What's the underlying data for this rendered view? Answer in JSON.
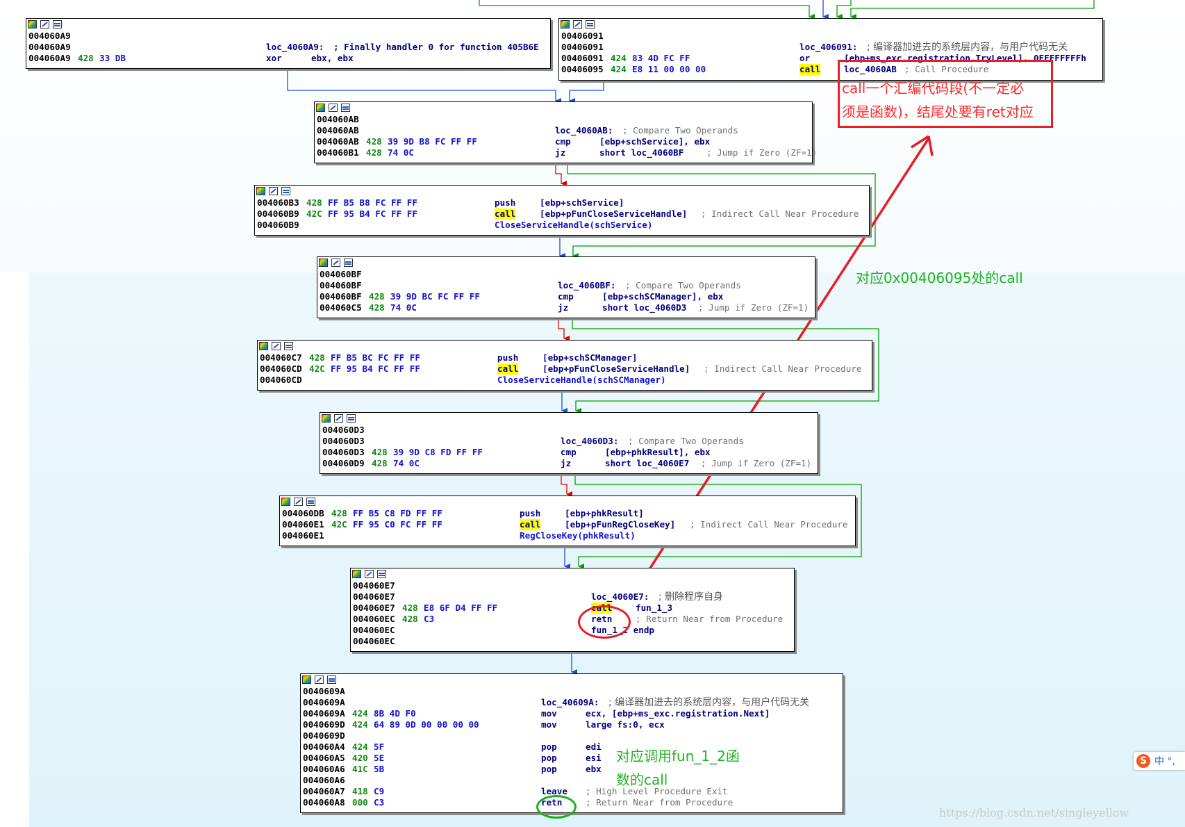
{
  "nodes": {
    "n1": {
      "lines": [
        {
          "addr": "004060A9"
        },
        {
          "addr": "004060A9",
          "label": "loc_4060A9:",
          "comment": "; Finally handler 0 for function 405B6E"
        },
        {
          "addr": "004060A9",
          "prefix": "428",
          "bytes": "33 DB",
          "mnem": "xor",
          "operand": "ebx, ebx"
        }
      ]
    },
    "n2": {
      "lines": [
        {
          "addr": "00406091"
        },
        {
          "addr": "00406091",
          "label": "loc_406091:",
          "comment": "; 编译器加进去的系统层内容，与用户代码无关"
        },
        {
          "addr": "00406091",
          "prefix": "424",
          "bytes": "83 4D FC FF",
          "mnem": "or",
          "operand": "[ebp+ms_exc.registration.TryLevel], 0FFFFFFFFh"
        },
        {
          "addr": "00406095",
          "prefix": "424",
          "bytes": "E8 11 00 00 00",
          "mnem": "call",
          "operand": "loc_4060AB",
          "comment": "; Call Procedure"
        }
      ]
    },
    "n3": {
      "lines": [
        {
          "addr": "004060AB"
        },
        {
          "addr": "004060AB",
          "label": "loc_4060AB:",
          "comment": "; Compare Two Operands"
        },
        {
          "addr": "004060AB",
          "prefix": "428",
          "bytes": "39 9D B8 FC FF FF",
          "mnem": "cmp",
          "operand": "[ebp+schService], ebx"
        },
        {
          "addr": "004060B1",
          "prefix": "428",
          "bytes": "74 0C",
          "mnem": "jz",
          "operand": "short loc_4060BF",
          "comment": "; Jump if Zero (ZF=1)"
        }
      ]
    },
    "n4": {
      "lines": [
        {
          "addr": "004060B3",
          "prefix": "428",
          "bytes": "FF B5 B8 FC FF FF",
          "mnem": "push",
          "operand": "[ebp+schService]"
        },
        {
          "addr": "004060B9",
          "prefix": "42C",
          "bytes": "FF 95 B4 FC FF FF",
          "mnem": "call",
          "operand": "[ebp+pFunCloseServiceHandle]",
          "comment": "; Indirect Call Near Procedure"
        },
        {
          "addr": "004060B9",
          "label": "CloseServiceHandle(schService)"
        }
      ]
    },
    "n5": {
      "lines": [
        {
          "addr": "004060BF"
        },
        {
          "addr": "004060BF",
          "label": "loc_4060BF:",
          "comment": "; Compare Two Operands"
        },
        {
          "addr": "004060BF",
          "prefix": "428",
          "bytes": "39 9D BC FC FF FF",
          "mnem": "cmp",
          "operand": "[ebp+schSCManager], ebx"
        },
        {
          "addr": "004060C5",
          "prefix": "428",
          "bytes": "74 0C",
          "mnem": "jz",
          "operand": "short loc_4060D3",
          "comment": "; Jump if Zero (ZF=1)"
        }
      ]
    },
    "n6": {
      "lines": [
        {
          "addr": "004060C7",
          "prefix": "428",
          "bytes": "FF B5 BC FC FF FF",
          "mnem": "push",
          "operand": "[ebp+schSCManager]"
        },
        {
          "addr": "004060CD",
          "prefix": "42C",
          "bytes": "FF 95 B4 FC FF FF",
          "mnem": "call",
          "operand": "[ebp+pFunCloseServiceHandle]",
          "comment": "; Indirect Call Near Procedure"
        },
        {
          "addr": "004060CD",
          "label": "CloseServiceHandle(schSCManager)"
        }
      ]
    },
    "n7": {
      "lines": [
        {
          "addr": "004060D3"
        },
        {
          "addr": "004060D3",
          "label": "loc_4060D3:",
          "comment": "; Compare Two Operands"
        },
        {
          "addr": "004060D3",
          "prefix": "428",
          "bytes": "39 9D C8 FD FF FF",
          "mnem": "cmp",
          "operand": "[ebp+phkResult], ebx"
        },
        {
          "addr": "004060D9",
          "prefix": "428",
          "bytes": "74 0C",
          "mnem": "jz",
          "operand": "short loc_4060E7",
          "comment": "; Jump if Zero (ZF=1)"
        }
      ]
    },
    "n8": {
      "lines": [
        {
          "addr": "004060DB",
          "prefix": "428",
          "bytes": "FF B5 C8 FD FF FF",
          "mnem": "push",
          "operand": "[ebp+phkResult]"
        },
        {
          "addr": "004060E1",
          "prefix": "42C",
          "bytes": "FF 95 C0 FC FF FF",
          "mnem": "call",
          "operand": "[ebp+pFunRegCloseKey]",
          "comment": "; Indirect Call Near Procedure"
        },
        {
          "addr": "004060E1",
          "label": "RegCloseKey(phkResult)"
        }
      ]
    },
    "n9": {
      "lines": [
        {
          "addr": "004060E7"
        },
        {
          "addr": "004060E7",
          "label": "loc_4060E7:",
          "comment": "; 删除程序自身"
        },
        {
          "addr": "004060E7",
          "prefix": "428",
          "bytes": "E8 6F D4 FF FF",
          "mnem": "call",
          "operand": "fun_1_3"
        },
        {
          "addr": "004060EC",
          "prefix": "428",
          "bytes": "C3",
          "mnem": "retn",
          "comment": "; Return Near from Procedure"
        },
        {
          "addr": "004060EC",
          "label": "fun_1_2 endp"
        },
        {
          "addr": "004060EC"
        }
      ]
    },
    "n10": {
      "lines": [
        {
          "addr": "0040609A"
        },
        {
          "addr": "0040609A",
          "label": "loc_40609A:",
          "comment": "; 编译器加进去的系统层内容，与用户代码无关"
        },
        {
          "addr": "0040609A",
          "prefix": "424",
          "bytes": "8B 4D F0",
          "mnem": "mov",
          "operand": "ecx, [ebp+ms_exc.registration.Next]"
        },
        {
          "addr": "0040609D",
          "prefix": "424",
          "bytes": "64 89 0D 00 00 00 00",
          "mnem": "mov",
          "operand": "large fs:0, ecx"
        },
        {
          "addr": "0040609D"
        },
        {
          "addr": "004060A4",
          "prefix": "424",
          "bytes": "5F",
          "mnem": "pop",
          "operand": "edi"
        },
        {
          "addr": "004060A5",
          "prefix": "420",
          "bytes": "5E",
          "mnem": "pop",
          "operand": "esi"
        },
        {
          "addr": "004060A6",
          "prefix": "41C",
          "bytes": "5B",
          "mnem": "pop",
          "operand": "ebx"
        },
        {
          "addr": "004060A6"
        },
        {
          "addr": "004060A7",
          "prefix": "418",
          "bytes": "C9",
          "mnem": "leave",
          "comment": "; High Level Procedure Exit"
        },
        {
          "addr": "004060A8",
          "prefix": "000",
          "bytes": "C3",
          "mnem": "retn",
          "comment": "; Return Near from Procedure"
        }
      ]
    }
  },
  "annotations": {
    "red_line1": "call一个汇编代码段(不一定必",
    "red_line2": "须是函数)，结尾处要有ret对应",
    "green_mid": "对应0x00406095处的call",
    "green_bottom_line1": "对应调用fun_1_2函",
    "green_bottom_line2": "数的call"
  },
  "watermark": "https://blog.csdn.net/singleyellow",
  "ime": {
    "logo": "S",
    "text": "中 °,"
  },
  "colors": {
    "address": "#000000",
    "bytes": "#1212d0",
    "stack_prefix": "#108810",
    "comment": "#707070",
    "call_highlight": "#ffff00",
    "edge_true": "#00a000",
    "edge_false": "#e00000",
    "edge_flow": "#1a4ed8",
    "annotation_red": "#ee1c24",
    "annotation_green": "#1eb41e"
  }
}
